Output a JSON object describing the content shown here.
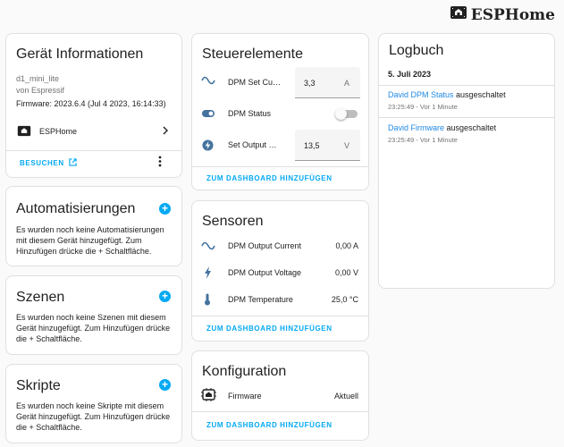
{
  "brand": {
    "name": "ESPHome",
    "icon": "esphome-logo-icon"
  },
  "device_info": {
    "title": "Gerät Informationen",
    "model": "d1_mini_lite",
    "manufacturer": "von Espressif",
    "firmware": "Firmware: 2023.6.4 (Jul 4 2023, 16:14:33)",
    "integration": "ESPHome",
    "visit_label": "BESUCHEN"
  },
  "automations": {
    "title": "Automatisierungen",
    "description": "Es wurden noch keine Automatisierungen mit diesem Gerät hinzugefügt. Zum Hinzufügen drücke die + Schaltfläche."
  },
  "scenes": {
    "title": "Szenen",
    "description": "Es wurden noch keine Szenen mit diesem Gerät hinzugefügt. Zum Hinzufügen drücke die + Schaltfläche."
  },
  "scripts": {
    "title": "Skripte",
    "description": "Es wurden noch keine Skripte mit diesem Gerät hinzugefügt. Zum Hinzufügen drücke die + Schaltfläche."
  },
  "controls": {
    "title": "Steuerelemente",
    "rows": [
      {
        "label": "DPM Set Current",
        "value": "3,3",
        "unit": "A"
      },
      {
        "label": "DPM Status",
        "state": "off"
      },
      {
        "label": "Set Output Voltage",
        "value": "13,5",
        "unit": "V"
      }
    ],
    "add_label": "ZUM DASHBOARD HINZUFÜGEN"
  },
  "sensors": {
    "title": "Sensoren",
    "rows": [
      {
        "label": "DPM Output Current",
        "value": "0,00 A"
      },
      {
        "label": "DPM Output Voltage",
        "value": "0,00 V"
      },
      {
        "label": "DPM Temperature",
        "value": "25,0 °C"
      }
    ],
    "add_label": "ZUM DASHBOARD HINZUFÜGEN"
  },
  "configuration": {
    "title": "Konfiguration",
    "rows": [
      {
        "label": "Firmware",
        "value": "Aktuell"
      }
    ],
    "add_label": "ZUM DASHBOARD HINZUFÜGEN"
  },
  "logbook": {
    "title": "Logbuch",
    "date": "5. Juli 2023",
    "entries": [
      {
        "entity": "David DPM Status",
        "action": "ausgeschaltet",
        "time": "23:25:49 - Vor 1 Minute"
      },
      {
        "entity": "David Firmware",
        "action": "ausgeschaltet",
        "time": "23:25:49 - Vor 1 Minute"
      }
    ]
  },
  "colors": {
    "accent": "#03a9f4",
    "link": "#1e88e5",
    "icon": "#44739e"
  }
}
